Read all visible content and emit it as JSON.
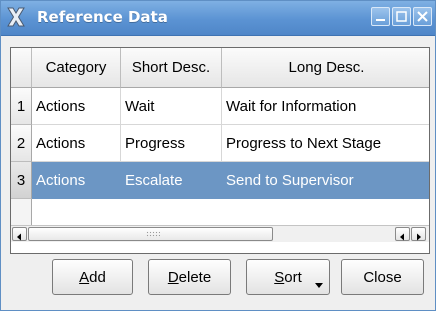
{
  "window": {
    "title": "Reference Data",
    "icon": "x-app-icon",
    "controls": [
      "minimize-icon",
      "maximize-icon",
      "close-icon"
    ]
  },
  "table": {
    "columns": [
      "Category",
      "Short Desc.",
      "Long Desc."
    ],
    "rows": [
      {
        "num": "1",
        "category": "Actions",
        "short": "Wait",
        "long": "Wait for Information"
      },
      {
        "num": "2",
        "category": "Actions",
        "short": "Progress",
        "long": "Progress to Next Stage"
      },
      {
        "num": "3",
        "category": "Actions",
        "short": "Escalate",
        "long": "Send to Supervisor"
      }
    ],
    "selected_row": "3"
  },
  "buttons": {
    "add": {
      "mnemonic": "A",
      "rest": "dd"
    },
    "delete": {
      "mnemonic": "D",
      "rest": "elete"
    },
    "sort": {
      "mnemonic": "S",
      "rest": "ort"
    },
    "close": {
      "label": "Close"
    }
  },
  "colors": {
    "titlebar": "#5b93d3",
    "selection": "#6c96c4"
  }
}
